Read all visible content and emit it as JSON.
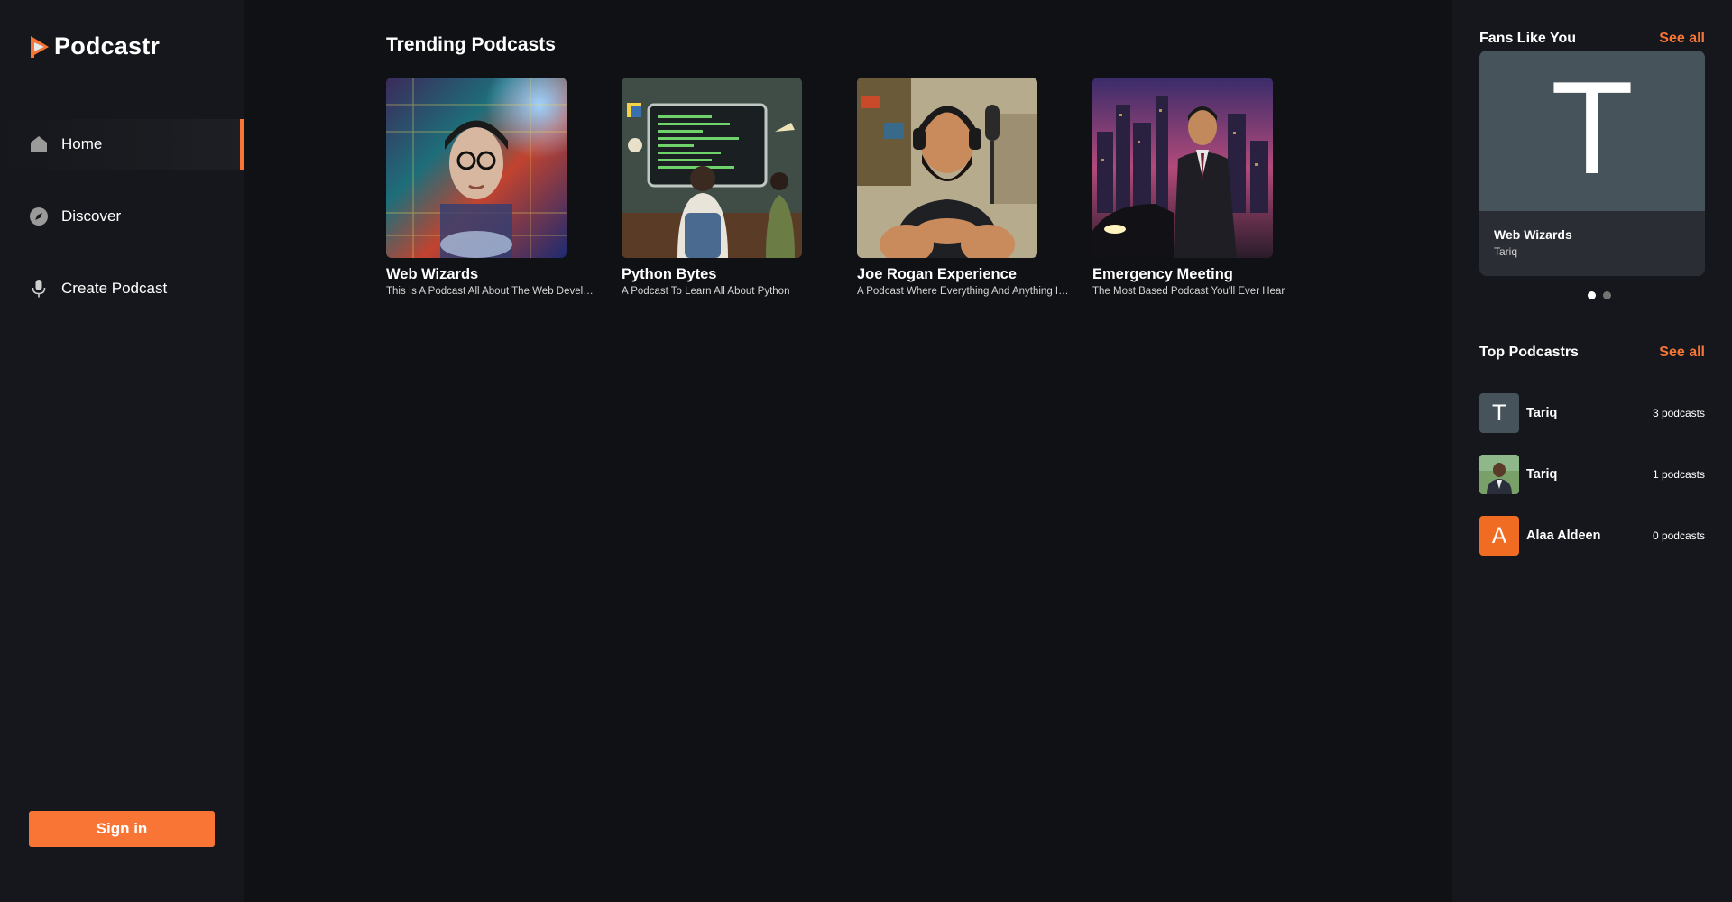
{
  "app": {
    "name": "Podcastr",
    "accent": "#f97535"
  },
  "sidebar": {
    "items": [
      {
        "label": "Home",
        "icon": "home-icon",
        "active": true
      },
      {
        "label": "Discover",
        "icon": "compass-icon",
        "active": false
      },
      {
        "label": "Create Podcast",
        "icon": "microphone-icon",
        "active": false
      }
    ],
    "signin_label": "Sign in"
  },
  "trending": {
    "title": "Trending Podcasts",
    "cards": [
      {
        "title": "Web Wizards",
        "description": "This Is A Podcast All About The Web Development"
      },
      {
        "title": "Python Bytes",
        "description": "A Podcast To Learn All About Python"
      },
      {
        "title": "Joe Rogan Experience",
        "description": "A Podcast Where Everything And Anything Is Discussed"
      },
      {
        "title": "Emergency Meeting",
        "description": "The Most Based Podcast You'll Ever Hear"
      }
    ]
  },
  "fans": {
    "title": "Fans Like You",
    "see_all": "See all",
    "card": {
      "letter": "T",
      "title": "Web Wizards",
      "author": "Tariq"
    },
    "slide_count": 2,
    "active_slide": 0
  },
  "top_podcastrs": {
    "title": "Top Podcastrs",
    "see_all": "See all",
    "items": [
      {
        "letter": "T",
        "name": "Tariq",
        "count": "3 podcasts",
        "avatar_color": "#47535a"
      },
      {
        "letter": "",
        "name": "Tariq",
        "count": "1 podcasts",
        "avatar_color": "#6b8f5a"
      },
      {
        "letter": "A",
        "name": "Alaa Aldeen",
        "count": "0 podcasts",
        "avatar_color": "#ef6c22"
      }
    ]
  }
}
